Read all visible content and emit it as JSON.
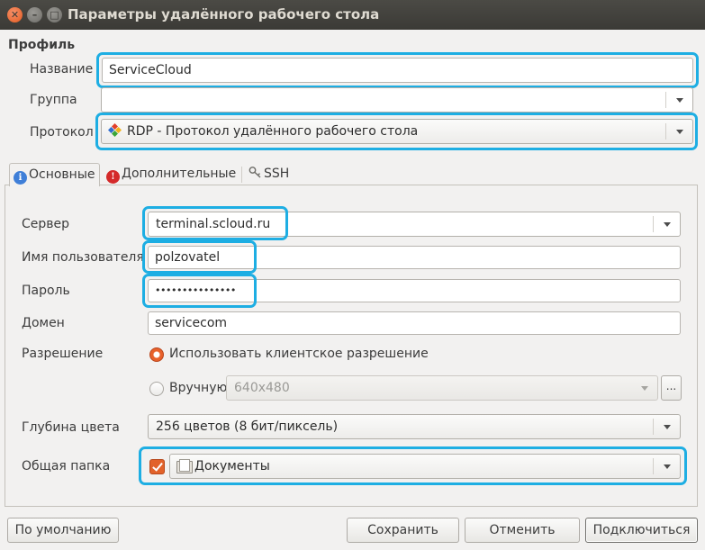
{
  "window": {
    "title": "Параметры удалённого рабочего стола",
    "close_glyph": "✕",
    "min_glyph": "–",
    "max_glyph": "□"
  },
  "profile": {
    "section_title": "Профиль",
    "name_label": "Название",
    "name_value": "ServiceCloud",
    "group_label": "Группа",
    "group_value": "",
    "protocol_label": "Протокол",
    "protocol_value": "RDP - Протокол удалённого рабочего стола"
  },
  "tabs": [
    {
      "label": "Основные",
      "icon": "info-icon",
      "active": true
    },
    {
      "label": "Дополнительные",
      "icon": "warning-icon",
      "active": false
    },
    {
      "label": "SSH",
      "icon": "key-icon",
      "active": false
    }
  ],
  "basic": {
    "server_label": "Сервер",
    "server_value": "terminal.scloud.ru",
    "username_label": "Имя пользователя",
    "username_value": "polzovatel",
    "password_label": "Пароль",
    "password_value": "•••••••••••••••",
    "domain_label": "Домен",
    "domain_value": "servicecom",
    "resolution_label": "Разрешение",
    "resolution_client_label": "Использовать клиентское разрешение",
    "resolution_client_selected": true,
    "resolution_manual_label": "Вручную",
    "resolution_manual_value": "640x480",
    "resolution_more_label": "...",
    "color_depth_label": "Глубина цвета",
    "color_depth_value": "256 цветов (8 бит/пиксель)",
    "shared_folder_label": "Общая папка",
    "shared_folder_checked": true,
    "shared_folder_value": "Документы"
  },
  "buttons": {
    "defaults": "По умолчанию",
    "save": "Сохранить",
    "cancel": "Отменить",
    "connect": "Подключиться"
  },
  "colors": {
    "highlight": "#1eaee3",
    "accent": "#e8612b"
  }
}
